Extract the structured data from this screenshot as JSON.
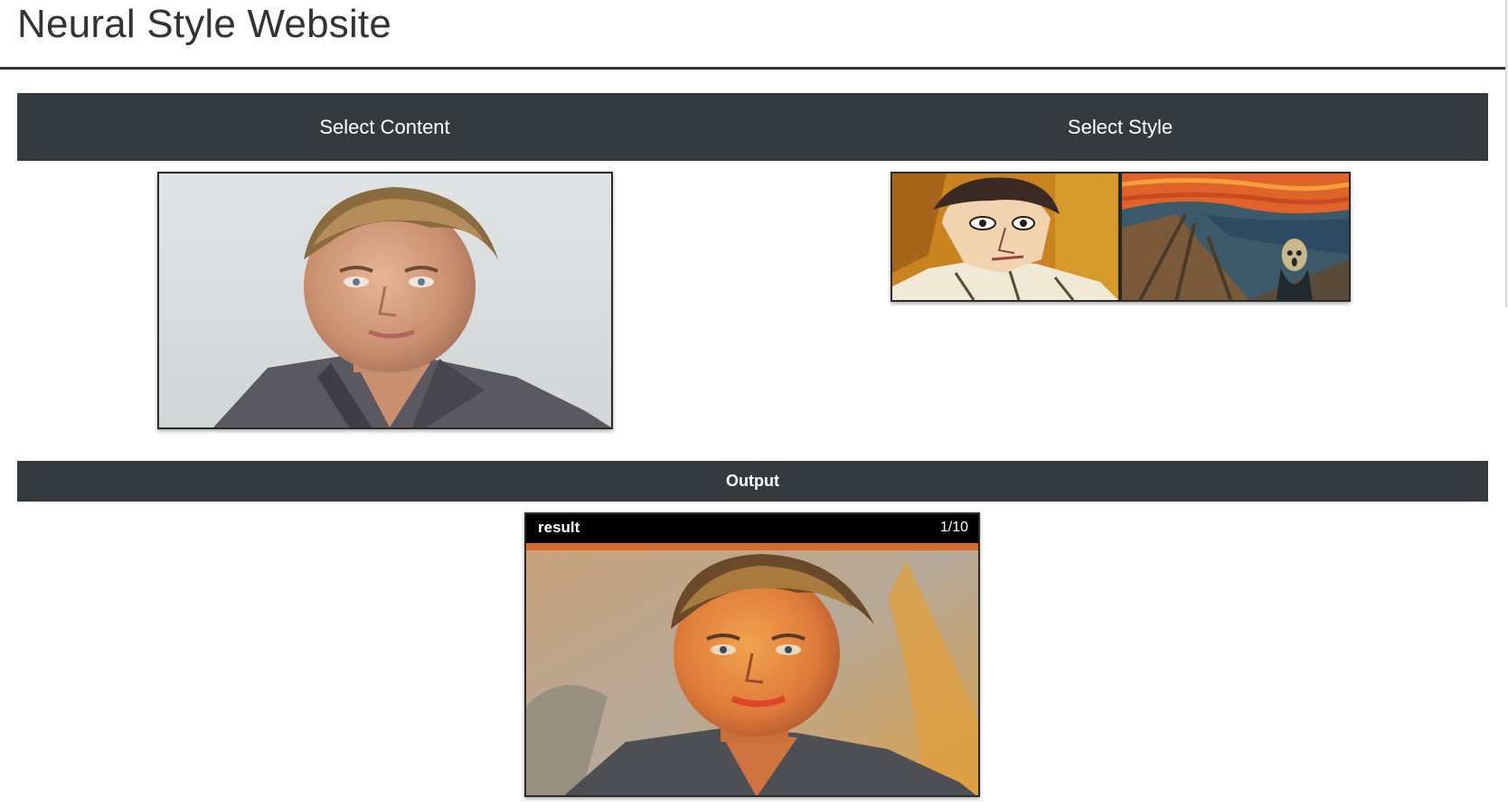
{
  "header": {
    "title": "Neural Style Website"
  },
  "selectors": {
    "content_label": "Select Content",
    "style_label": "Select Style"
  },
  "output": {
    "section_label": "Output",
    "card_label": "result",
    "counter": "1/10"
  },
  "colors": {
    "bar_background": "#353a3e",
    "bar_text": "#ffffff",
    "title_text": "#333333",
    "card_header": "#000000"
  },
  "images": {
    "content": "portrait-photo",
    "style_1": "cubist-self-portrait-painting",
    "style_2": "the-scream-painting",
    "result": "stylized-portrait"
  }
}
